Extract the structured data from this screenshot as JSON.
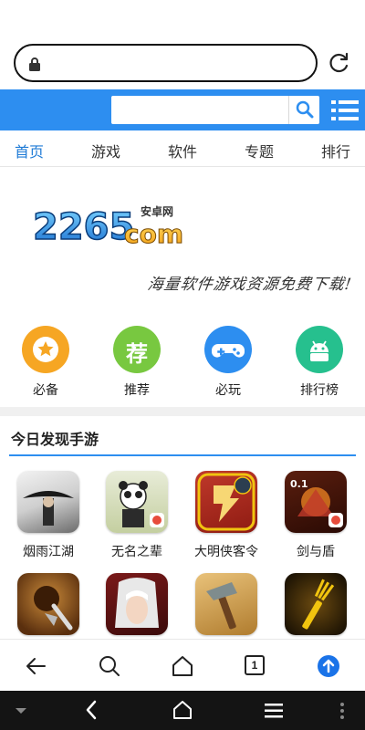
{
  "browser": {
    "url_value": "",
    "tab_count": "1"
  },
  "site": {
    "search_placeholder": "",
    "nav_tabs": [
      {
        "label": "首页",
        "active": true
      },
      {
        "label": "游戏",
        "active": false
      },
      {
        "label": "软件",
        "active": false
      },
      {
        "label": "专题",
        "active": false
      },
      {
        "label": "排行",
        "active": false
      }
    ],
    "logo_text": "2265",
    "logo_suffix": "com",
    "logo_cn": "安卓网",
    "slogan": "海量软件游戏资源免费下载!"
  },
  "quick_links": [
    {
      "label": "必备",
      "color": "#f6a623",
      "icon": "star-icon"
    },
    {
      "label": "推荐",
      "color": "#78c840",
      "icon": "recommend-icon",
      "glyph": "荐"
    },
    {
      "label": "必玩",
      "color": "#2d8ef0",
      "icon": "gamepad-icon"
    },
    {
      "label": "排行榜",
      "color": "#26c08e",
      "icon": "android-icon"
    }
  ],
  "section": {
    "title": "今日发现手游"
  },
  "games": [
    {
      "name": "烟雨江湖"
    },
    {
      "name": "无名之辈"
    },
    {
      "name": "大明侠客令"
    },
    {
      "name": "剑与盾"
    },
    {
      "name": ""
    },
    {
      "name": ""
    },
    {
      "name": ""
    },
    {
      "name": ""
    }
  ],
  "colors": {
    "header_blue": "#2d8ef0",
    "active_tab": "#1f7bd6"
  }
}
